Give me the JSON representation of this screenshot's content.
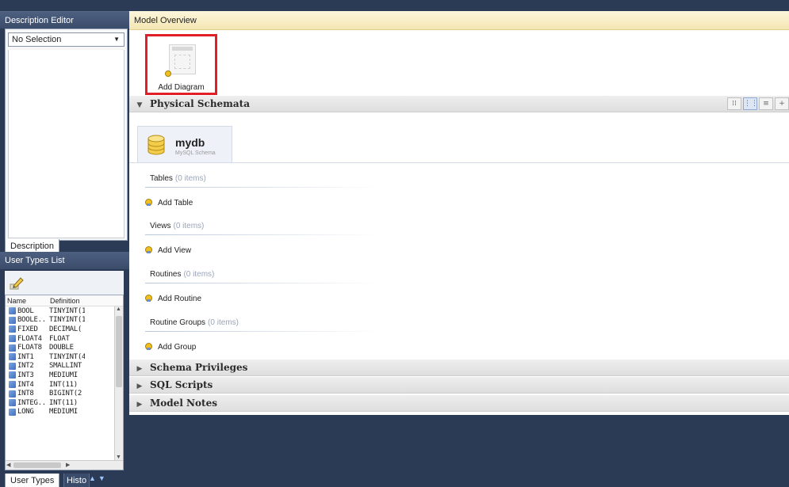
{
  "description_editor": {
    "title": "Description Editor",
    "selection": "No Selection",
    "tab_label": "Description"
  },
  "user_types": {
    "title": "User Types List",
    "columns": [
      "Name",
      "Definition"
    ],
    "rows": [
      {
        "name": "BOOL",
        "def": "TINYINT(1"
      },
      {
        "name": "BOOLE...",
        "def": "TINYINT(1"
      },
      {
        "name": "FIXED",
        "def": "DECIMAL("
      },
      {
        "name": "FLOAT4",
        "def": "FLOAT"
      },
      {
        "name": "FLOAT8",
        "def": "DOUBLE"
      },
      {
        "name": "INT1",
        "def": "TINYINT(4"
      },
      {
        "name": "INT2",
        "def": "SMALLINT"
      },
      {
        "name": "INT3",
        "def": "MEDIUMI"
      },
      {
        "name": "INT4",
        "def": "INT(11)"
      },
      {
        "name": "INT8",
        "def": "BIGINT(2"
      },
      {
        "name": "INTEG...",
        "def": "INT(11)"
      },
      {
        "name": "LONG",
        "def": "MEDIUMI"
      }
    ],
    "tab_user_types": "User Types",
    "tab_history": "Histo"
  },
  "overview": {
    "title": "Model Overview",
    "add_diagram_label": "Add Diagram",
    "physical_schemata": "Physical Schemata",
    "schema": {
      "name": "mydb",
      "subtitle": "MySQL Schema"
    },
    "groups": [
      {
        "title": "Tables",
        "count": "(0 items)",
        "add": "Add Table"
      },
      {
        "title": "Views",
        "count": "(0 items)",
        "add": "Add View"
      },
      {
        "title": "Routines",
        "count": "(0 items)",
        "add": "Add Routine"
      },
      {
        "title": "Routine Groups",
        "count": "(0 items)",
        "add": "Add Group"
      }
    ],
    "schema_privileges": "Schema Privileges",
    "sql_scripts": "SQL Scripts",
    "model_notes": "Model Notes"
  },
  "icons": {
    "types_toolbar": "pencil-edit-icon",
    "type_row": "user-type-icon",
    "schema": "database-icon",
    "add": "add-plus-icon"
  },
  "colors": {
    "background": "#2b3a55",
    "highlight_box": "#e01f26",
    "header_yellow": "#f4e6b3"
  }
}
